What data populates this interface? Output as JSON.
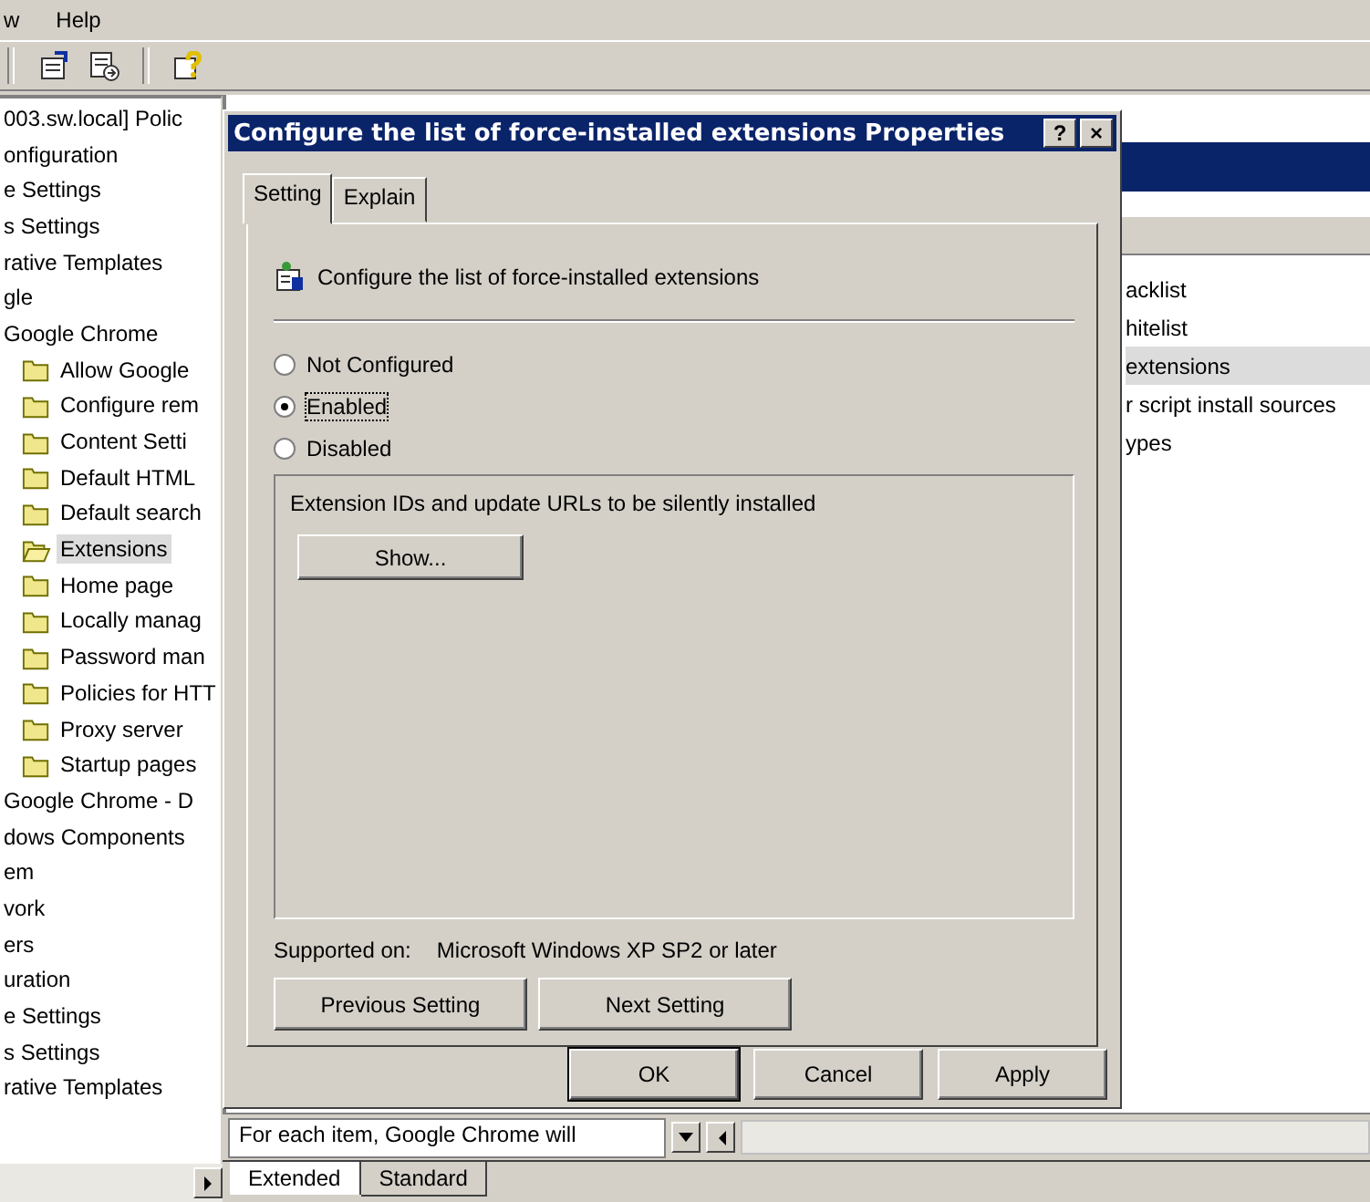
{
  "menu": [
    {
      "label": "w"
    },
    {
      "label": "Help"
    }
  ],
  "tree": {
    "items": [
      {
        "label": "003.sw.local] Polic",
        "selected": false
      },
      {
        "label": "onfiguration",
        "selected": false
      },
      {
        "label": "e Settings",
        "selected": false
      },
      {
        "label": "s Settings",
        "selected": false
      },
      {
        "label": "rative Templates",
        "selected": false
      },
      {
        "label": "gle",
        "selected": false
      },
      {
        "label": "Google Chrome",
        "selected": false,
        "children": [
          {
            "label": "Allow Google",
            "selected": false
          },
          {
            "label": "Configure rem",
            "selected": false
          },
          {
            "label": "Content Setti",
            "selected": false
          },
          {
            "label": "Default HTML",
            "selected": false
          },
          {
            "label": "Default search",
            "selected": false
          },
          {
            "label": "Extensions",
            "selected": true
          },
          {
            "label": "Home page",
            "selected": false
          },
          {
            "label": "Locally manag",
            "selected": false
          },
          {
            "label": "Password man",
            "selected": false
          },
          {
            "label": "Policies for HTT",
            "selected": false
          },
          {
            "label": "Proxy server",
            "selected": false
          },
          {
            "label": "Startup pages",
            "selected": false
          }
        ]
      },
      {
        "label": "Google Chrome - D",
        "selected": false
      },
      {
        "label": "dows Components",
        "selected": false
      },
      {
        "label": "em",
        "selected": false
      },
      {
        "label": "vork",
        "selected": false
      },
      {
        "label": "ers",
        "selected": false
      },
      {
        "label": "uration",
        "selected": false
      },
      {
        "label": "e Settings",
        "selected": false
      },
      {
        "label": "s Settings",
        "selected": false
      },
      {
        "label": "rative Templates",
        "selected": false
      }
    ]
  },
  "details": {
    "items": [
      {
        "label": "acklist",
        "selected": false
      },
      {
        "label": "hitelist",
        "selected": false
      },
      {
        "label": "extensions",
        "selected": true
      },
      {
        "label": "r script install sources",
        "selected": false
      },
      {
        "label": "ypes",
        "selected": false
      }
    ]
  },
  "description": "For each item, Google Chrome will",
  "view_tabs": [
    {
      "label": "Extended",
      "selected": true
    },
    {
      "label": "Standard",
      "selected": false
    }
  ],
  "dialog": {
    "title": "Configure the list of force-installed extensions Properties",
    "help_button": "?",
    "close_button": "×",
    "tabs": [
      {
        "label": "Setting",
        "selected": true
      },
      {
        "label": "Explain",
        "selected": false
      }
    ],
    "policy_title": "Configure the list of force-installed extensions",
    "options": [
      {
        "label": "Not Configured",
        "selected": false
      },
      {
        "label": "Enabled",
        "selected": true
      },
      {
        "label": "Disabled",
        "selected": false
      }
    ],
    "group_label": "Extension IDs and update URLs to be silently installed",
    "show_button": "Show...",
    "supported_label": "Supported on:",
    "supported_value": "Microsoft Windows XP SP2 or later",
    "nav_buttons": [
      "Previous Setting",
      "Next Setting"
    ],
    "buttons": [
      {
        "label": "OK",
        "default": true
      },
      {
        "label": "Cancel",
        "default": false
      },
      {
        "label": "Apply",
        "default": false
      }
    ]
  }
}
